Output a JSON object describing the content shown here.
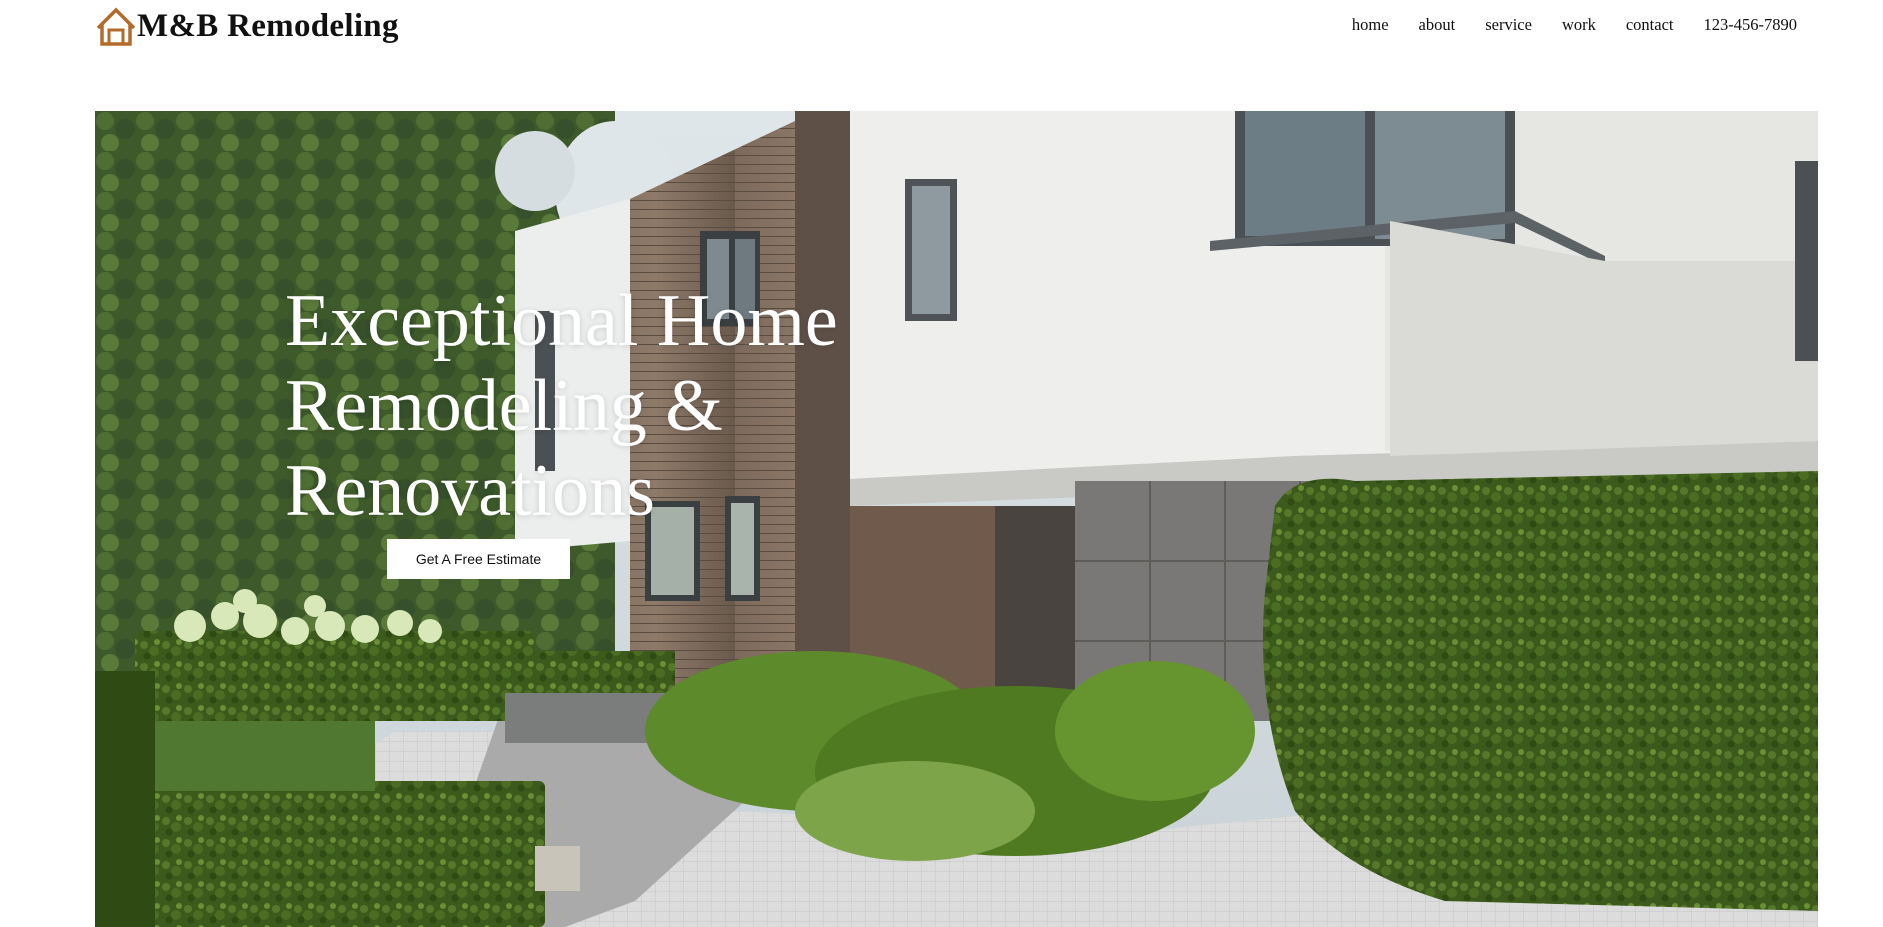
{
  "brand": {
    "name": "M&B Remodeling",
    "icon": "house-outline-icon",
    "accent_color": "#b36b2c"
  },
  "nav": {
    "items": [
      {
        "label": "home"
      },
      {
        "label": "about"
      },
      {
        "label": "service"
      },
      {
        "label": "work"
      },
      {
        "label": "contact"
      },
      {
        "label": "123-456-7890"
      }
    ]
  },
  "hero": {
    "title": "Exceptional Home Remodeling & Renovations",
    "cta_label": "Get A Free Estimate",
    "image": "modern-house-with-garden-photo"
  }
}
